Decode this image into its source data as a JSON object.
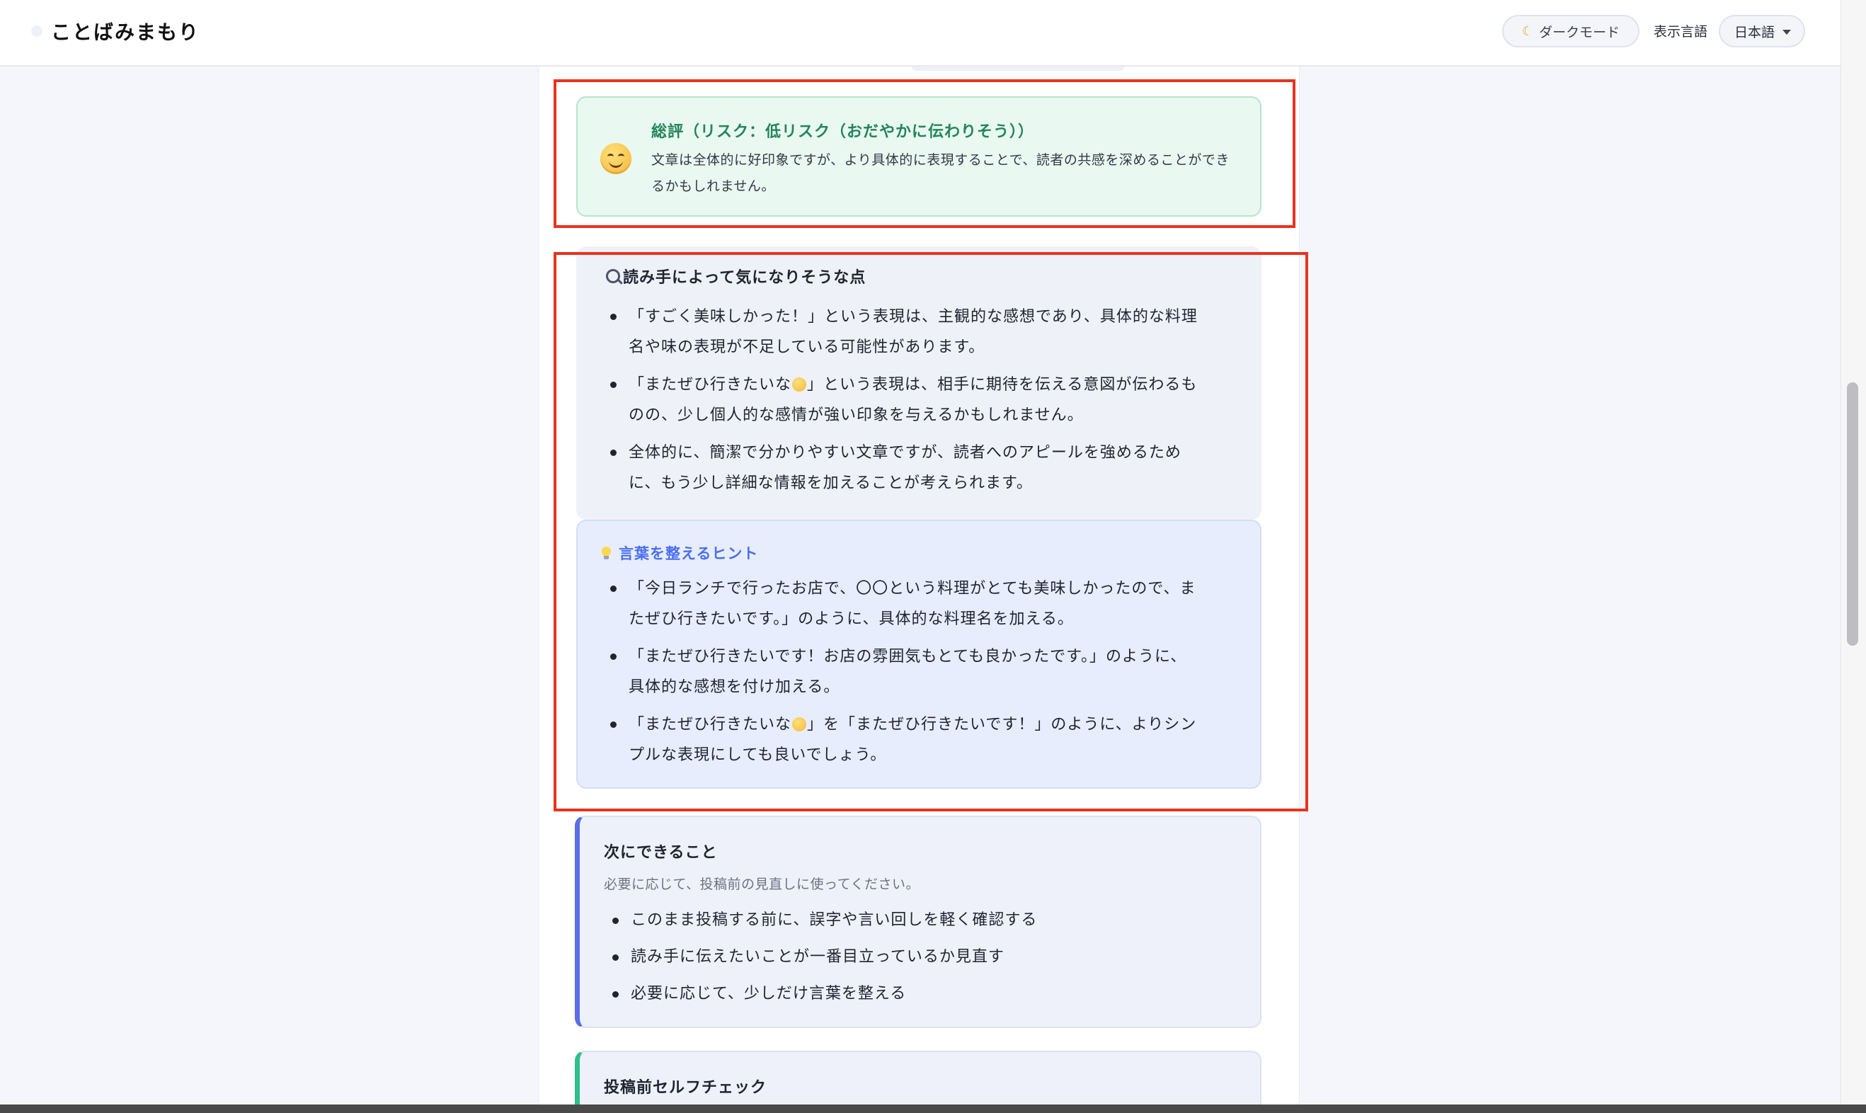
{
  "header": {
    "app_title": "ことばみまもり",
    "dark_mode_label": "ダークモード",
    "language_label": "表示言語",
    "language_selected": "日本語"
  },
  "summary": {
    "title": "総評（リスク：低リスク（おだやかに伝わりそう））",
    "body": "文章は全体的に好印象ですが、より具体的に表現することで、読者の共感を深めることができるかもしれません。",
    "icon": "smiling-face-icon"
  },
  "concerns": {
    "heading": "読み手によって気になりそうな点",
    "items": [
      {
        "line1": "「すごく美味しかった！」という表現は、主観的な感想であり、具体的な料理",
        "line2": "名や味の表現が不足している可能性があります。"
      },
      {
        "line1a": "「またぜひ行きたいな",
        "line1b": "」という表現は、相手に期待を伝える意図が伝わるも",
        "line2": "のの、少し個人的な感情が強い印象を与えるかもしれません。"
      },
      {
        "line1": "全体的に、簡潔で分かりやすい文章ですが、読者へのアピールを強めるため",
        "line2": "に、もう少し詳細な情報を加えることが考えられます。"
      }
    ]
  },
  "hints": {
    "heading": "言葉を整えるヒント",
    "items": [
      {
        "line1": "「今日ランチで行ったお店で、〇〇という料理がとても美味しかったので、ま",
        "line2": "たぜひ行きたいです。」のように、具体的な料理名を加える。"
      },
      {
        "line1": "「またぜひ行きたいです！お店の雰囲気もとても良かったです。」のように、",
        "line2": "具体的な感想を付け加える。"
      },
      {
        "line1a": "「またぜひ行きたいな",
        "line1b": "」を「またぜひ行きたいです！」のように、よりシン",
        "line2": "プルな表現にしても良いでしょう。"
      }
    ]
  },
  "next_steps": {
    "heading": "次にできること",
    "subtitle": "必要に応じて、投稿前の見直しに使ってください。",
    "items": [
      "このまま投稿する前に、誤字や言い回しを軽く確認する",
      "読み手に伝えたいことが一番目立っているか見直す",
      "必要に応じて、少しだけ言葉を整える"
    ]
  },
  "self_check": {
    "heading": "投稿前セルフチェック"
  },
  "colors": {
    "accent_blue": "#5a6ee8",
    "summary_green": "#23855c",
    "annotation_red": "#e8331f",
    "check_green": "#2fbf8a"
  }
}
